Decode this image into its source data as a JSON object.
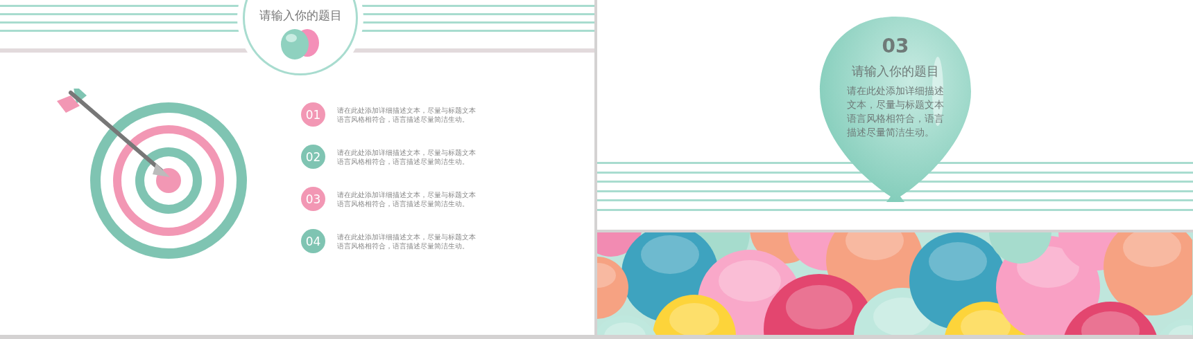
{
  "left_slide": {
    "title": "请输入你的题目",
    "items": [
      {
        "number": "01",
        "color": "#f297b4",
        "text": "请在此处添加详细描述文本，尽量与标题文本语言风格相符合，语言描述尽量简洁生动。"
      },
      {
        "number": "02",
        "color": "#7fc4b2",
        "text": "请在此处添加详细描述文本，尽量与标题文本语言风格相符合，语言描述尽量简洁生动。"
      },
      {
        "number": "03",
        "color": "#f297b4",
        "text": "请在此处添加详细描述文本，尽量与标题文本语言风格相符合，语言描述尽量简洁生动。"
      },
      {
        "number": "04",
        "color": "#7fc4b2",
        "text": "请在此处添加详细描述文本，尽量与标题文本语言风格相符合，语言描述尽量简洁生动。"
      }
    ]
  },
  "right_slide": {
    "number": "03",
    "title": "请输入你的题目",
    "body": "请在此处添加详细描述文本，尽量与标题文本语言风格相符合，语言描述尽量简洁生动。"
  }
}
